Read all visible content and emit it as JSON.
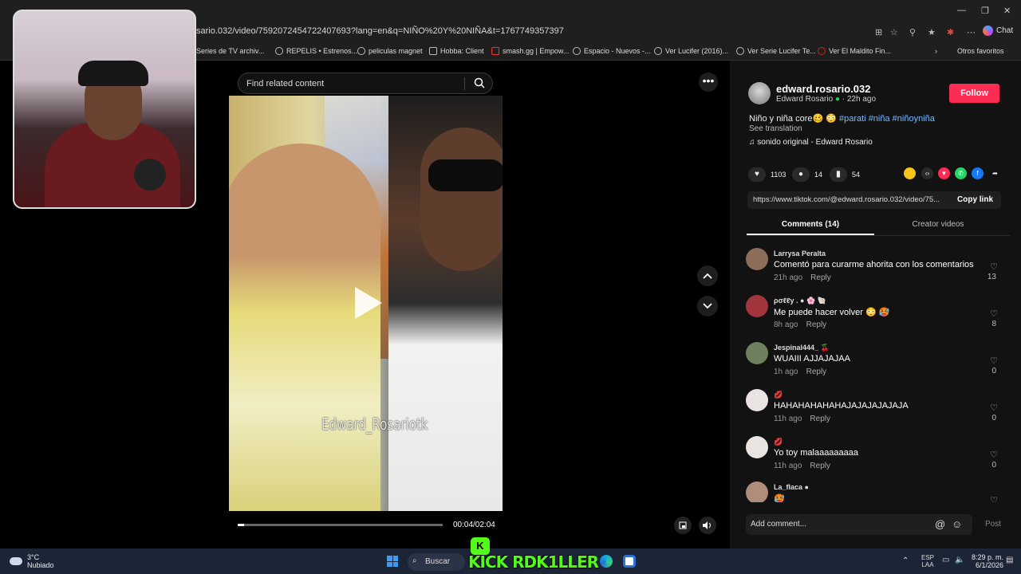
{
  "browser": {
    "url": "sario.032/video/7592072454722407693?lang=en&q=NIÑO%20Y%20NIÑA&t=1767749357397",
    "chat_label": "Chat",
    "bookmarks": [
      "Series de TV archiv...",
      "REPELIS • Estrenos...",
      "peliculas magnet",
      "Hobba: Client",
      "smash.gg | Empow...",
      "Espacio - Nuevos -...",
      "Ver Lucifer (2016)...",
      "Ver Serie Lucifer Te...",
      "Ver El Maldito Fin..."
    ],
    "other_favorites": "Otros favoritos"
  },
  "player": {
    "search_placeholder": "Find related content",
    "watermark": "Edward_Rosariotk",
    "time": "00:04/02:04",
    "progress": 0.033
  },
  "author": {
    "username": "edward.rosario.032",
    "display_name": "Edward Rosario",
    "verified_icon": "●",
    "age": "22h ago",
    "follow_label": "Follow"
  },
  "post": {
    "caption_text": "Niño y niña core🥴 😳",
    "caption_tags": "#parati #niña #niñoyniña",
    "see_translation": "See translation",
    "sound": "sonido original - Edward Rosario"
  },
  "stats": {
    "likes": "1103",
    "comments": "14",
    "saves": "54"
  },
  "link": {
    "url": "https://www.tiktok.com/@edward.rosario.032/video/75...",
    "copy_label": "Copy link"
  },
  "tabs": {
    "comments": "Comments (14)",
    "creator": "Creator videos"
  },
  "comments": [
    {
      "name": "Larrysa Peralta",
      "text": "Comentó para curarme ahorita con los comentarios",
      "time": "21h ago",
      "reply": "Reply",
      "likes": "13",
      "color": "#8c6d5a"
    },
    {
      "name": "ρσℓℓу . ● 🌸 🐚",
      "text": "Me puede hacer volver 😳 🥵",
      "time": "8h ago",
      "reply": "Reply",
      "likes": "8",
      "color": "#a3353e"
    },
    {
      "name": "Jespinal444_ 🍒",
      "text": "WUAIII AJJAJAJAA",
      "time": "1h ago",
      "reply": "Reply",
      "likes": "0",
      "color": "#6f8060"
    },
    {
      "name": "💋",
      "text": "HAHAHAHAHAHAJAJAJAJAJAJA",
      "time": "11h ago",
      "reply": "Reply",
      "likes": "0",
      "color": "#e9e4e2"
    },
    {
      "name": "💋",
      "text": "Yo toy malaaaaaaaaa",
      "time": "11h ago",
      "reply": "Reply",
      "likes": "0",
      "color": "#e9e4e2"
    },
    {
      "name": "La_flaca ●",
      "text": "🥵",
      "time": "",
      "reply": "",
      "likes": "",
      "color": "#b08c7c"
    }
  ],
  "composer": {
    "placeholder": "Add comment...",
    "post_label": "Post"
  },
  "taskbar": {
    "temperature": "3°C",
    "weather": "Nubiado",
    "search_label": "Buscar",
    "overlay_text": "KICK RDK1LLER",
    "lang_top": "ESP",
    "lang_bottom": "LAA",
    "time": "8:29 p. m.",
    "date": "6/1/2026"
  },
  "colors": {
    "follow": "#fe2c55",
    "link": "#7eb8ff",
    "kick": "#53fc18"
  }
}
